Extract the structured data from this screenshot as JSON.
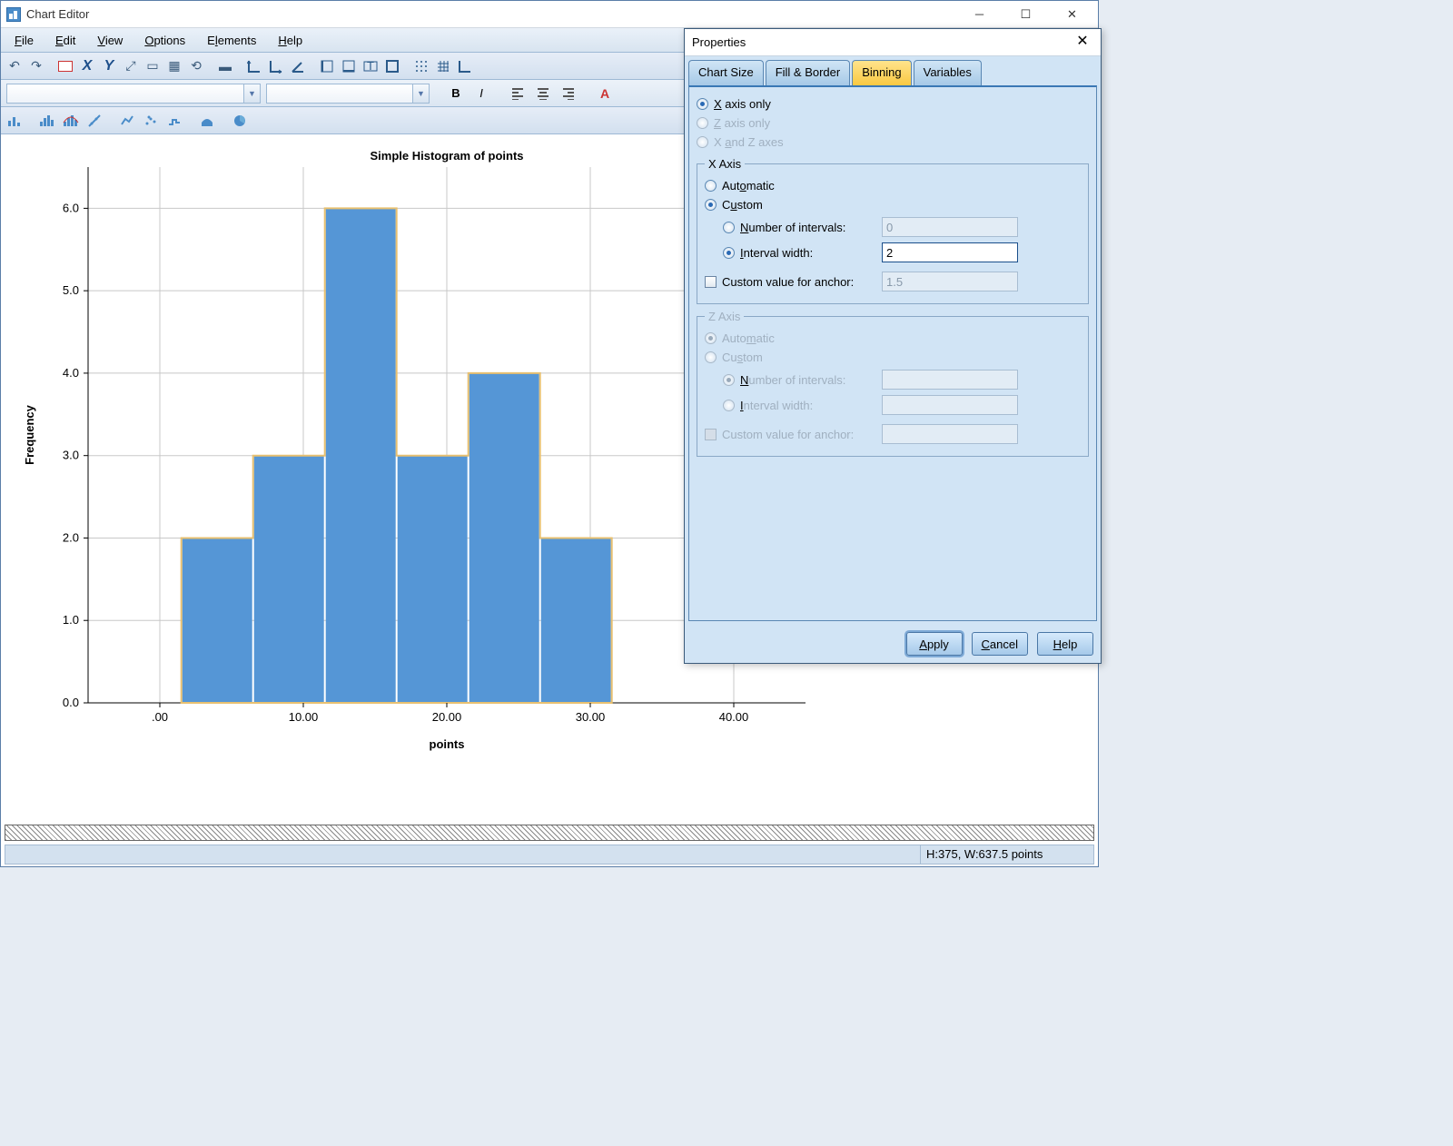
{
  "window": {
    "title": "Chart Editor"
  },
  "menu": {
    "file": "File",
    "edit": "Edit",
    "view": "View",
    "options": "Options",
    "elements": "Elements",
    "help": "Help"
  },
  "format": {
    "bold": "B",
    "italic": "I",
    "text_a": "A"
  },
  "status": {
    "dims": "H:375, W:637.5 points"
  },
  "dialog": {
    "title": "Properties",
    "tabs": {
      "chart_size": "Chart Size",
      "fill_border": "Fill & Border",
      "binning": "Binning",
      "variables": "Variables"
    },
    "axis_opts": {
      "x_only": "X axis only",
      "z_only": "Z axis only",
      "xz": "X and Z axes"
    },
    "x_legend": "X Axis",
    "z_legend": "Z Axis",
    "auto": "Automatic",
    "custom": "Custom",
    "num_int": "Number of intervals:",
    "num_int_val": "0",
    "int_width": "Interval width:",
    "int_width_val": "2",
    "anchor": "Custom value for anchor:",
    "anchor_val": "1.5",
    "apply": "Apply",
    "cancel": "Cancel",
    "help": "Help"
  },
  "chart_data": {
    "type": "bar",
    "title": "Simple Histogram of points",
    "xlabel": "points",
    "ylabel": "Frequency",
    "categories": [
      ".00",
      "10.00",
      "20.00",
      "30.00",
      "40.00"
    ],
    "bins": [
      {
        "x0": 1.5,
        "x1": 6.5,
        "y": 2
      },
      {
        "x0": 6.5,
        "x1": 11.5,
        "y": 3
      },
      {
        "x0": 11.5,
        "x1": 16.5,
        "y": 6
      },
      {
        "x0": 16.5,
        "x1": 21.5,
        "y": 3
      },
      {
        "x0": 21.5,
        "x1": 26.5,
        "y": 4
      },
      {
        "x0": 26.5,
        "x1": 31.5,
        "y": 2
      }
    ],
    "xlim": [
      -5,
      45
    ],
    "ylim": [
      0,
      6.5
    ],
    "yticks": [
      0.0,
      1.0,
      2.0,
      3.0,
      4.0,
      5.0,
      6.0
    ],
    "xticks": [
      0,
      10,
      20,
      30,
      40
    ]
  }
}
